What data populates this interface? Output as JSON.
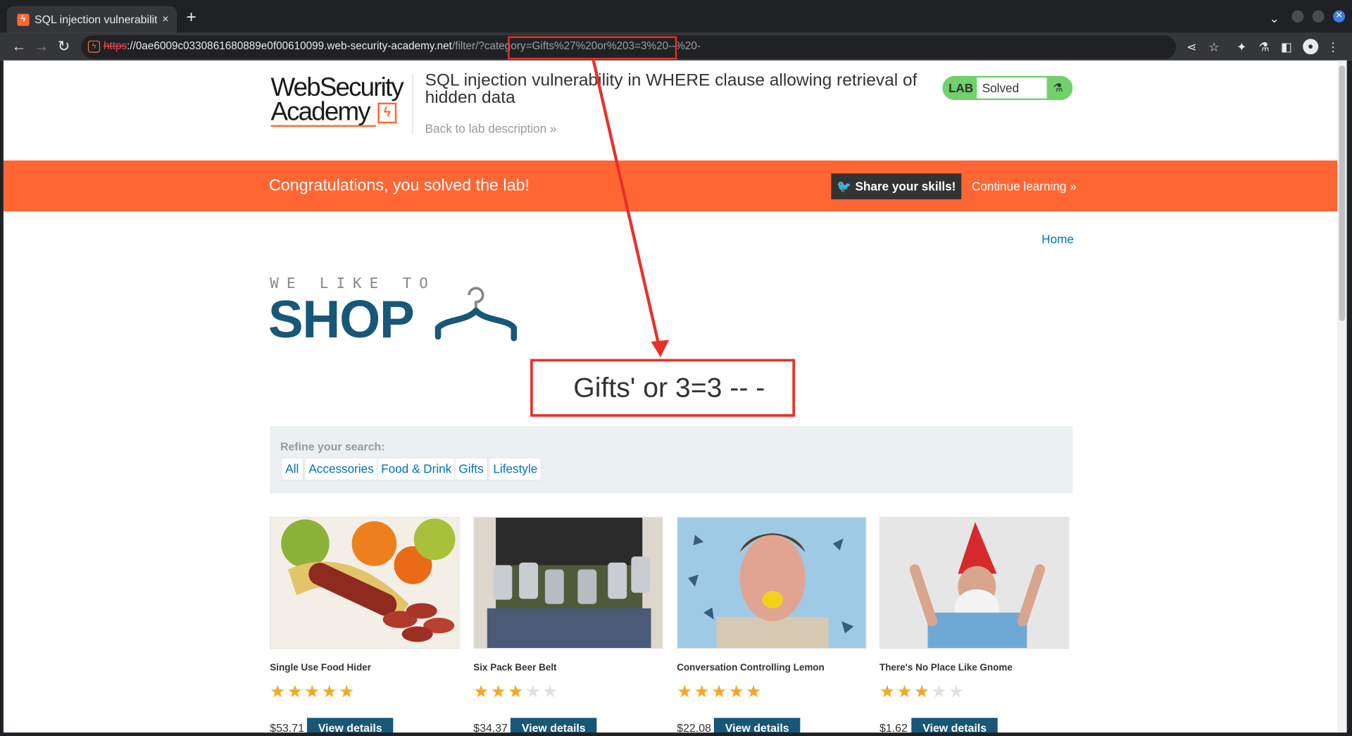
{
  "browser": {
    "tab_title": "SQL injection vulnerability",
    "tab_close": "×",
    "new_tab": "+",
    "url_scheme": "https",
    "url_host": "://0ae6009c0330861680889e0f00610099.web-security-academy.net",
    "url_path": "/filter/?category=",
    "url_query": "Gifts%27%20or%203=3%20--%20-"
  },
  "header": {
    "logo_line1": "WebSecurity",
    "logo_line2": "Academy",
    "lab_title": "SQL injection vulnerability in WHERE clause allowing retrieval of hidden data",
    "back_link": "Back to lab description",
    "badge_label": "LAB",
    "badge_status": "Solved"
  },
  "banner": {
    "message": "Congratulations, you solved the lab!",
    "share_label": "Share your skills!",
    "continue_label": "Continue learning"
  },
  "nav": {
    "home": "Home"
  },
  "shop": {
    "tagline": "WE LIKE TO",
    "name": "SHOP"
  },
  "category_heading": "Gifts' or 3=3 -- -",
  "filters": {
    "label": "Refine your search:",
    "items": [
      "All",
      "Accessories",
      "Food & Drink",
      "Gifts",
      "Lifestyle"
    ]
  },
  "products": [
    {
      "name": "Single Use Food Hider",
      "rating": 5,
      "price": "$53.71",
      "button": "View details",
      "icon": "food-image"
    },
    {
      "name": "Six Pack Beer Belt",
      "rating": 3,
      "price": "$34.37",
      "button": "View details",
      "icon": "beer-belt-image"
    },
    {
      "name": "Conversation Controlling Lemon",
      "rating": 5,
      "price": "$22.08",
      "button": "View details",
      "icon": "lemon-image"
    },
    {
      "name": "There's No Place Like Gnome",
      "rating": 3,
      "price": "$1.62",
      "button": "View details",
      "icon": "gnome-image"
    }
  ],
  "colors": {
    "accent": "#ff6633",
    "brand_blue": "#175778",
    "annotation_red": "#e8302a",
    "solved_green": "#70d16d"
  }
}
